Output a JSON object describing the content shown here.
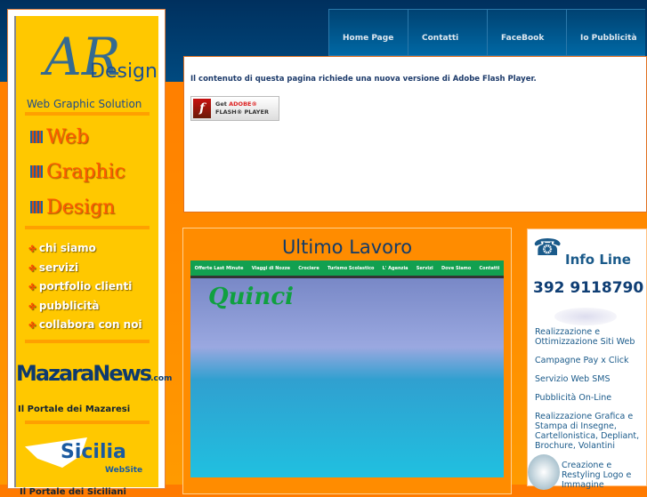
{
  "nav": [
    "Home Page",
    "Contatti",
    "FaceBook",
    "Io Pubblicità"
  ],
  "flash": {
    "message": "Il contenuto di questa pagina richiede una nuova versione di Adobe Flash Player.",
    "button_get": "Get",
    "button_adobe": "ADOBE®",
    "button_player": "FLASH® PLAYER"
  },
  "sidebar": {
    "logo_letters": "AR",
    "logo_design": "Design",
    "tagline": "Web Graphic Solution",
    "big": [
      "Web",
      "Graphic",
      "Design"
    ],
    "menu": [
      "chi siamo",
      "servizi",
      "portfolio clienti",
      "pubblicità",
      "collabora con noi"
    ],
    "mazaranews": "MazaraNews",
    "mazaranews_com": ".com",
    "mazaranews_tag": "Il Portale dei Mazaresi",
    "sicilia": "Sicilia",
    "sicilia_sub": "WebSite",
    "sicilia_tag": "Il Portale dei Siciliani"
  },
  "ultimo": {
    "title": "Ultimo Lavoro",
    "nav": [
      "Offerte Last Minute",
      "Viaggi di Nozze",
      "Crociere",
      "Turismo Scolastico",
      "L' Agenzia",
      "Servizi",
      "Dove Siamo",
      "Contatti"
    ],
    "brand": "Quinci"
  },
  "info": {
    "title": "Info Line",
    "phone": "392 9118790",
    "links": [
      "Realizzazione e Ottimizzazione Siti Web",
      "Campagne Pay x Click",
      "Servizio Web SMS",
      "Pubblicità On-Line",
      "Realizzazione Grafica e Stampa di Insegne, Cartellonistica, Depliant, Brochure, Volantini"
    ],
    "last": "Creazione e Restyling Logo e Immagine"
  }
}
